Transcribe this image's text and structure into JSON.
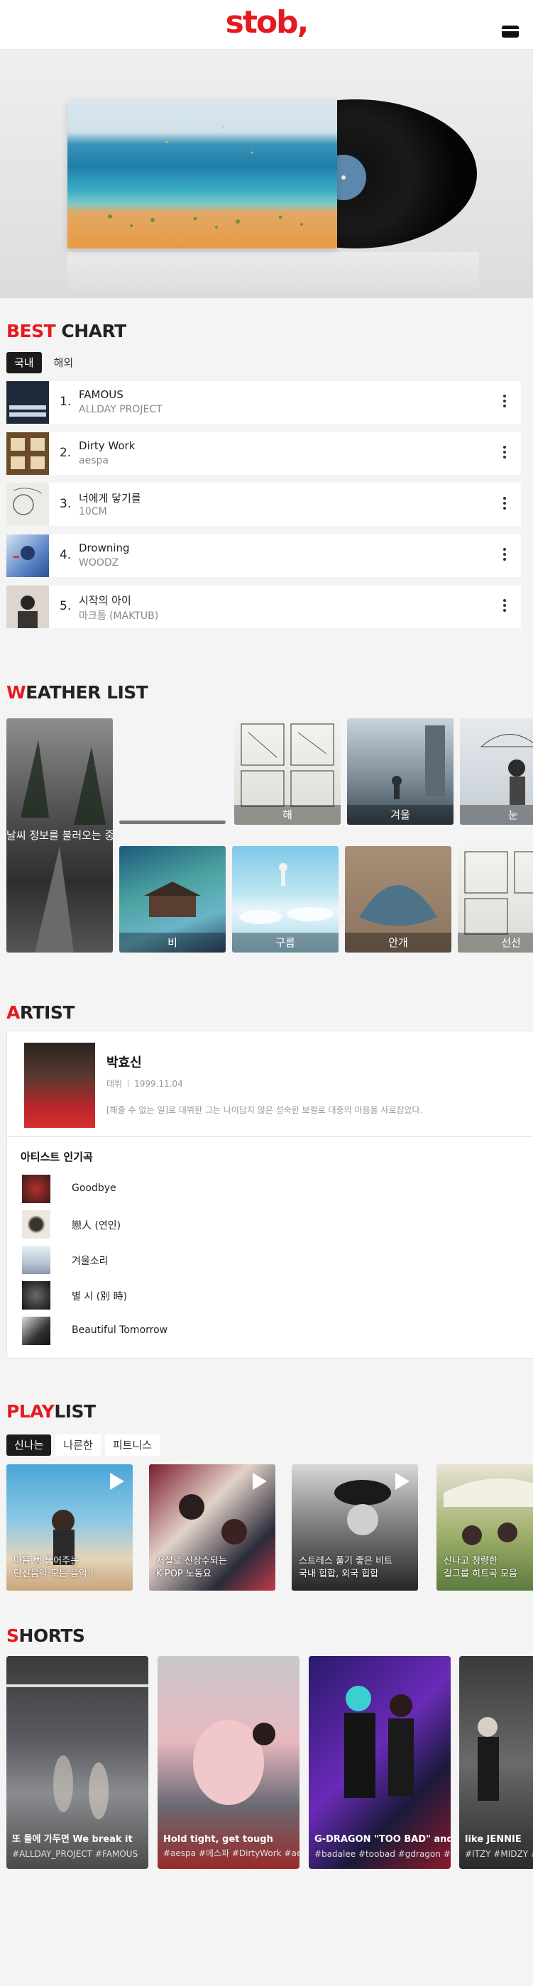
{
  "header": {
    "logo": "stob,",
    "card_icon": "card-icon"
  },
  "best_chart": {
    "title_accent": "BEST",
    "title_rest": " CHART",
    "tabs": [
      "국내",
      "해외"
    ],
    "active_tab": 0,
    "items": [
      {
        "rank": "1.",
        "song": "FAMOUS",
        "artist": "ALLDAY PROJECT",
        "thumb_color": "#1e2a3a"
      },
      {
        "rank": "2.",
        "song": "Dirty Work",
        "artist": "aespa",
        "thumb_color": "#6b4b2a"
      },
      {
        "rank": "3.",
        "song": "너에게 닿기를",
        "artist": "10CM",
        "thumb_color": "#e7e7e2"
      },
      {
        "rank": "4.",
        "song": "Drowning",
        "artist": "WOODZ",
        "thumb_color": "#3e6fb5"
      },
      {
        "rank": "5.",
        "song": "시작의 아이",
        "artist": "마크툽 (MAKTUB)",
        "thumb_color": "#d9d3cc"
      }
    ]
  },
  "weather_list": {
    "title_accent": "W",
    "title_rest": "EATHER LIST",
    "loading_text": "날씨 정보를 불러오는 중...",
    "tiles": [
      {
        "label": "해"
      },
      {
        "label": "겨울"
      },
      {
        "label": "눈"
      },
      {
        "label": "비"
      },
      {
        "label": "구름"
      },
      {
        "label": "안개"
      },
      {
        "label": "선선"
      }
    ]
  },
  "artist": {
    "title_accent": "A",
    "title_rest": "RTIST",
    "name": "박효신",
    "debut_label": "데뷔",
    "debut_date": "1999.11.04",
    "description": "[해줄 수 없는 일]로 데뷔한 그는 나이답지 않은 성숙한 보컬로 대중의 마음을 사로잡았다.",
    "popular_title": "아티스트 인기곡",
    "songs": [
      "Goodbye",
      "戀人 (연인)",
      "겨울소리",
      "별 시 (別 時)",
      "Beautiful Tomorrow"
    ]
  },
  "playlist": {
    "title_accent": "PLAY",
    "title_rest": "LIST",
    "tabs": [
      "신나는",
      "나른한",
      "피트니스"
    ],
    "active_tab": 0,
    "cards": [
      {
        "line1": "마음 뻥 뚫어주는",
        "line2": "단신음악 모든 음악 !"
      },
      {
        "line1": "저절로 신상수되는",
        "line2": "K-POP 노동요"
      },
      {
        "line1": "스트레스 풀기 좋은 비트",
        "line2": "국내 힙합, 외국 힙합"
      },
      {
        "line1": "신나고 청량한",
        "line2": "걸그룹 히트곡 모음"
      }
    ]
  },
  "shorts": {
    "title_accent": "S",
    "title_rest": "HORTS",
    "cards": [
      {
        "title": "또 들에 가두면 We break it",
        "tags": "#ALLDAY_PROJECT #FAMOUS"
      },
      {
        "title": "Hold tight, get tough",
        "tags": "#aespa #에스파 #DirtyWork #ae"
      },
      {
        "title": "G-DRAGON \"TOO BAD\" and BA",
        "tags": "#badalee #toobad #gdragon #c"
      },
      {
        "title": "like JENNIE",
        "tags": "#ITZY #MIDZY #c"
      }
    ]
  }
}
